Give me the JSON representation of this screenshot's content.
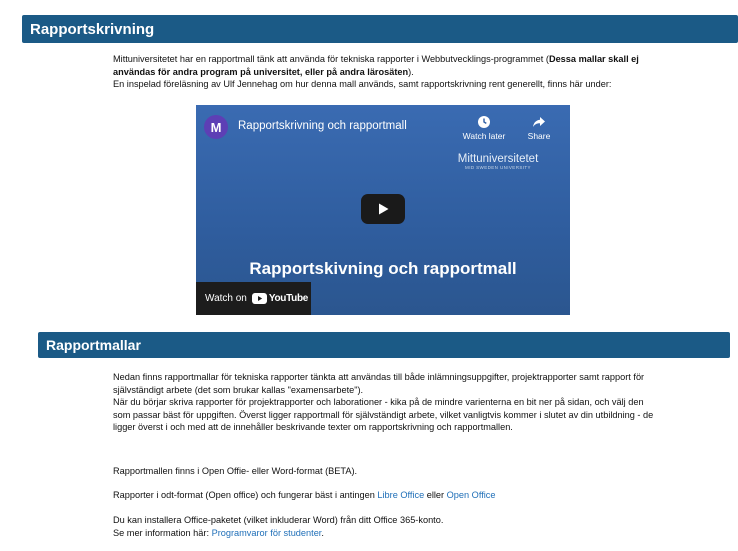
{
  "section1": {
    "title": "Rapportskrivning",
    "intro_text": "Mittuniversitetet har en rapportmall tänk att använda för tekniska rapporter i Webbutvecklings-programmet (",
    "intro_bold": "Dessa mallar skall ej användas för andra program på universitet, eller på andra lärosäten",
    "intro_end": ").",
    "lecture_text": "En inspelad föreläsning av Ulf Jennehag om hur denna mall används, samt rapportskrivning rent generellt, finns här under:"
  },
  "video": {
    "channel_initial": "M",
    "title": "Rapportskrivning och rapportmall",
    "watch_later": "Watch later",
    "share": "Share",
    "brand": "Mittuniversitetet",
    "brand_sub": "MID SWEDEN UNIVERSITY",
    "big_title": "Rapportskivning och rapportmall",
    "watch_on": "Watch on",
    "youtube": "YouTube"
  },
  "section2": {
    "title": "Rapportmallar",
    "p1": "Nedan finns rapportmallar för tekniska rapporter tänkta att användas till både inlämningsuppgifter, projektrapporter samt rapport för självständigt arbete (det som brukar kallas \"examensarbete\").",
    "p2": "När du börjar skriva rapporter för projektrapporter och laborationer - kika på de mindre varienterna en bit ner på sidan, och välj den som passar bäst för uppgiften. Överst ligger rapportmall för självständigt arbete, vilket vanligtvis kommer i slutet av din utbildning - de ligger överst i och med att de innehåller beskrivande texter om rapportskrivning och rapportmallen.",
    "p3": "Rapportmallen finns i Open Offie- eller Word-format (BETA).",
    "p4_text": "Rapporter i odt-format (Open office) och fungerar bäst i antingen ",
    "p4_link1": "Libre Office",
    "p4_mid": " eller ",
    "p4_link2": "Open Office",
    "p5_line1": "Du kan installera Office-paketet (vilket inkluderar Word) från ditt Office 365-konto.",
    "p5_text": "Se mer information här: ",
    "p5_link": "Programvaror för studenter",
    "p5_end": "."
  }
}
